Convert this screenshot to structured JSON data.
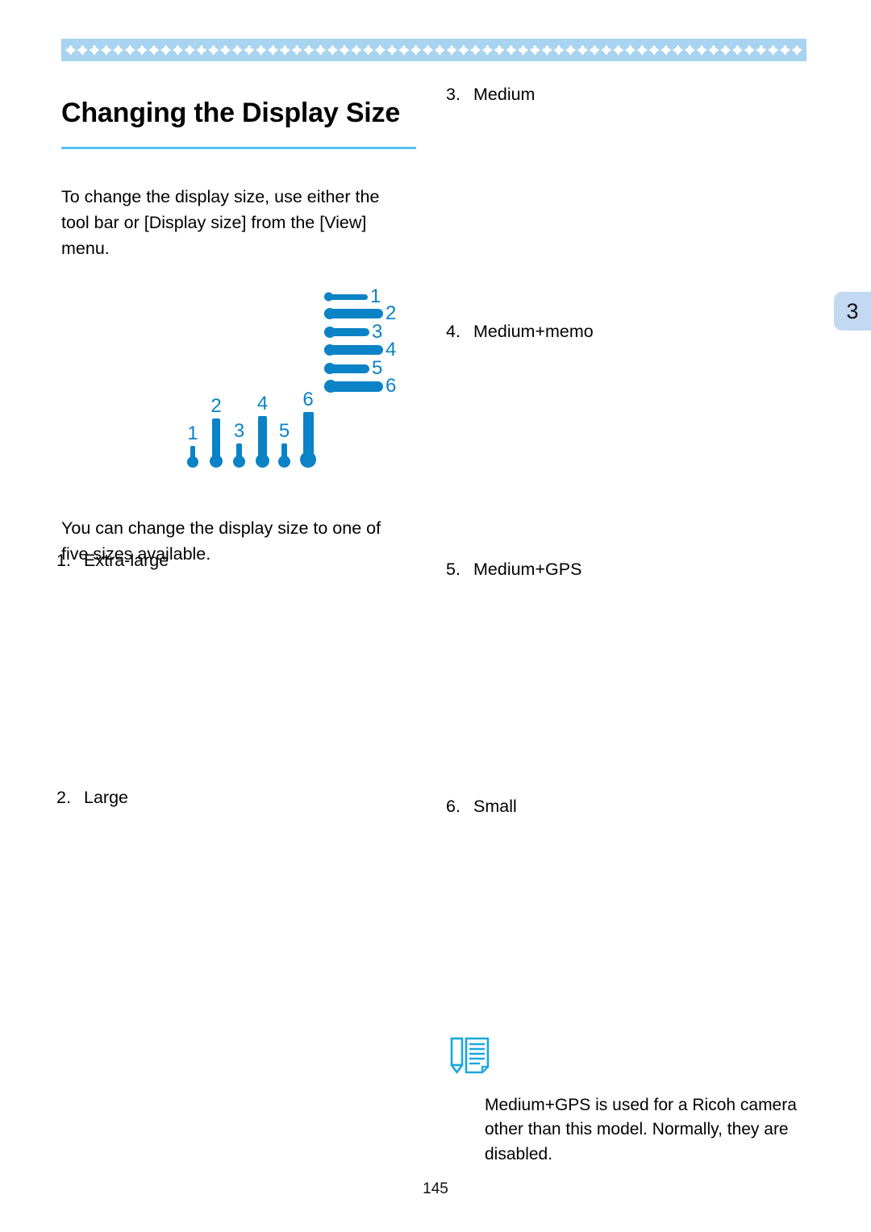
{
  "document": {
    "page_number": "145",
    "chapter_tab": "3"
  },
  "header": {
    "band_motif_icon": "diamond-cluster-motif",
    "band_color": "#a8d4f0",
    "motif_color": "#ffffff"
  },
  "title": {
    "text": "Changing the Display Size",
    "rule_color": "#58c2ef"
  },
  "intro": {
    "paragraph": "To change the display size, use either the tool bar or [Display size] from the [View] menu."
  },
  "body": {
    "paragraph": "You can change the display size to one of five sizes available."
  },
  "sizes": [
    {
      "num": "1.",
      "label": "Extra-large"
    },
    {
      "num": "2.",
      "label": "Large"
    },
    {
      "num": "3.",
      "label": "Medium"
    },
    {
      "num": "4.",
      "label": "Medium+memo"
    },
    {
      "num": "5.",
      "label": "Medium+GPS"
    },
    {
      "num": "6.",
      "label": "Small"
    }
  ],
  "diagrams": {
    "accent_color": "#0b83c6",
    "horizontal_pins": {
      "caption_icon": "toolbar-display-size-icons-horizontal",
      "numbers": [
        "1",
        "2",
        "3",
        "4",
        "5",
        "6"
      ]
    },
    "vertical_pins": {
      "caption_icon": "toolbar-display-size-icons-vertical",
      "numbers": [
        "1",
        "2",
        "3",
        "4",
        "5",
        "6"
      ]
    }
  },
  "note": {
    "icon": "memo-note-icon",
    "text": "Medium+GPS is used for a Ricoh camera other than this model. Normally, they are disabled."
  }
}
